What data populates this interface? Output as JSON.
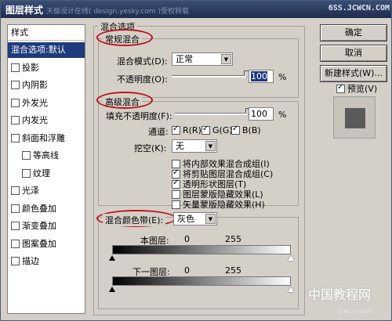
{
  "window": {
    "title": "图层样式",
    "watermark_left": "天极设计在线( design.yesky.com )受权转载",
    "watermark_right": "6SS.JCWCN.COM",
    "watermark_bottom": "中国教程网",
    "watermark_bottom_url": "jcwcn.com"
  },
  "style_list": {
    "header": "样式",
    "items": [
      {
        "label": "混合选项:默认",
        "checkbox": false,
        "checked": false,
        "selected": true,
        "indent": false
      },
      {
        "label": "投影",
        "checkbox": true,
        "checked": false,
        "selected": false,
        "indent": false
      },
      {
        "label": "内阴影",
        "checkbox": true,
        "checked": false,
        "selected": false,
        "indent": false
      },
      {
        "label": "外发光",
        "checkbox": true,
        "checked": false,
        "selected": false,
        "indent": false
      },
      {
        "label": "内发光",
        "checkbox": true,
        "checked": false,
        "selected": false,
        "indent": false
      },
      {
        "label": "斜面和浮雕",
        "checkbox": true,
        "checked": false,
        "selected": false,
        "indent": false
      },
      {
        "label": "等高线",
        "checkbox": true,
        "checked": false,
        "selected": false,
        "indent": true
      },
      {
        "label": "纹理",
        "checkbox": true,
        "checked": false,
        "selected": false,
        "indent": true
      },
      {
        "label": "光泽",
        "checkbox": true,
        "checked": false,
        "selected": false,
        "indent": false
      },
      {
        "label": "颜色叠加",
        "checkbox": true,
        "checked": false,
        "selected": false,
        "indent": false
      },
      {
        "label": "渐变叠加",
        "checkbox": true,
        "checked": false,
        "selected": false,
        "indent": false
      },
      {
        "label": "图案叠加",
        "checkbox": true,
        "checked": false,
        "selected": false,
        "indent": false
      },
      {
        "label": "描边",
        "checkbox": true,
        "checked": false,
        "selected": false,
        "indent": false
      }
    ]
  },
  "blend_options": {
    "title": "混合选项",
    "general": {
      "title": "常规混合",
      "mode_label": "混合模式(D):",
      "mode_value": "正常",
      "opacity_label": "不透明度(O):",
      "opacity_value": "100",
      "opacity_unit": "%",
      "opacity_fraction": 1.0
    },
    "advanced": {
      "title": "高级混合",
      "fill_label": "填充不透明度(F):",
      "fill_value": "100",
      "fill_unit": "%",
      "fill_fraction": 1.0,
      "channels_label": "通道:",
      "channels": [
        {
          "label": "R(R)",
          "checked": true
        },
        {
          "label": "G(G)",
          "checked": true
        },
        {
          "label": "B(B)",
          "checked": true
        }
      ],
      "knockout_label": "挖空(K):",
      "knockout_value": "无",
      "options": [
        {
          "label": "将内部效果混合成组(I)",
          "checked": false
        },
        {
          "label": "将剪贴图层混合成组(C)",
          "checked": true
        },
        {
          "label": "透明形状图层(T)",
          "checked": true
        },
        {
          "label": "图层蒙版隐藏效果(L)",
          "checked": false
        },
        {
          "label": "矢量蒙版隐藏效果(H)",
          "checked": false
        }
      ]
    },
    "blend_if": {
      "label": "混合颜色带(E):",
      "value": "灰色",
      "this_layer_label": "本图层:",
      "this_low": "0",
      "this_high": "255",
      "under_layer_label": "下一图层:",
      "under_low": "0",
      "under_high": "255"
    }
  },
  "buttons": {
    "ok": "确定",
    "cancel": "取消",
    "new_style": "新建样式(W)...",
    "preview_label": "预览(V)",
    "preview_checked": true
  },
  "colors": {
    "annotation": "#c0101a",
    "selection": "#1e3b7c",
    "dialog_bg": "#d4d0c8"
  }
}
